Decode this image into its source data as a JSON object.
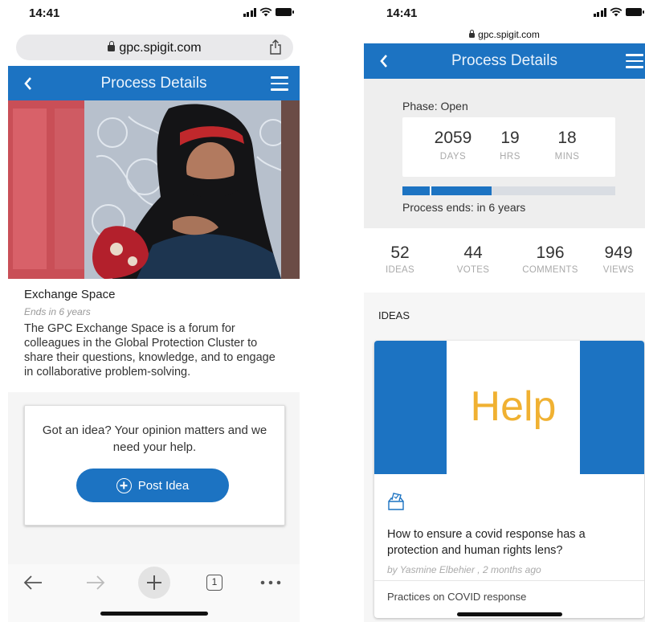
{
  "left": {
    "status": {
      "time": "14:41"
    },
    "browser": {
      "url": "gpc.spigit.com"
    },
    "header": {
      "title": "Process Details"
    },
    "space": {
      "title": "Exchange Space",
      "ends": "Ends in 6 years",
      "description": "The GPC Exchange Space is a forum for colleagues in the Global Protection Cluster to share their questions, knowledge, and to engage in collaborative problem-solving."
    },
    "cta": {
      "prompt": "Got an idea? Your opinion matters and we need your help.",
      "button_label": "Post Idea"
    },
    "toolbar": {
      "tab_count": "1"
    },
    "colors": {
      "brand_blue": "#1c73c2"
    }
  },
  "right": {
    "status": {
      "time": "14:41"
    },
    "browser": {
      "url": "gpc.spigit.com"
    },
    "header": {
      "title": "Process Details"
    },
    "phase": {
      "label": "Phase:",
      "value": "Open",
      "days": "2059",
      "days_label": "DAYS",
      "hrs": "19",
      "hrs_label": "HRS",
      "mins": "18",
      "mins_label": "MINS",
      "progress_fraction": 0.42,
      "ends_label": "Process ends:",
      "ends_value": "in 6 years"
    },
    "stats": [
      {
        "num": "52",
        "label": "IDEAS"
      },
      {
        "num": "44",
        "label": "VOTES"
      },
      {
        "num": "196",
        "label": "COMMENTS"
      },
      {
        "num": "949",
        "label": "VIEWS"
      }
    ],
    "ideas": {
      "heading": "IDEAS",
      "card": {
        "image_text": "Help",
        "title": "How to ensure a covid response has a protection and human rights lens?",
        "byline": "by Yasmine Elbehier ,  2 months ago",
        "category": "Practices on COVID response",
        "icon": "ballot-box-icon"
      }
    }
  }
}
